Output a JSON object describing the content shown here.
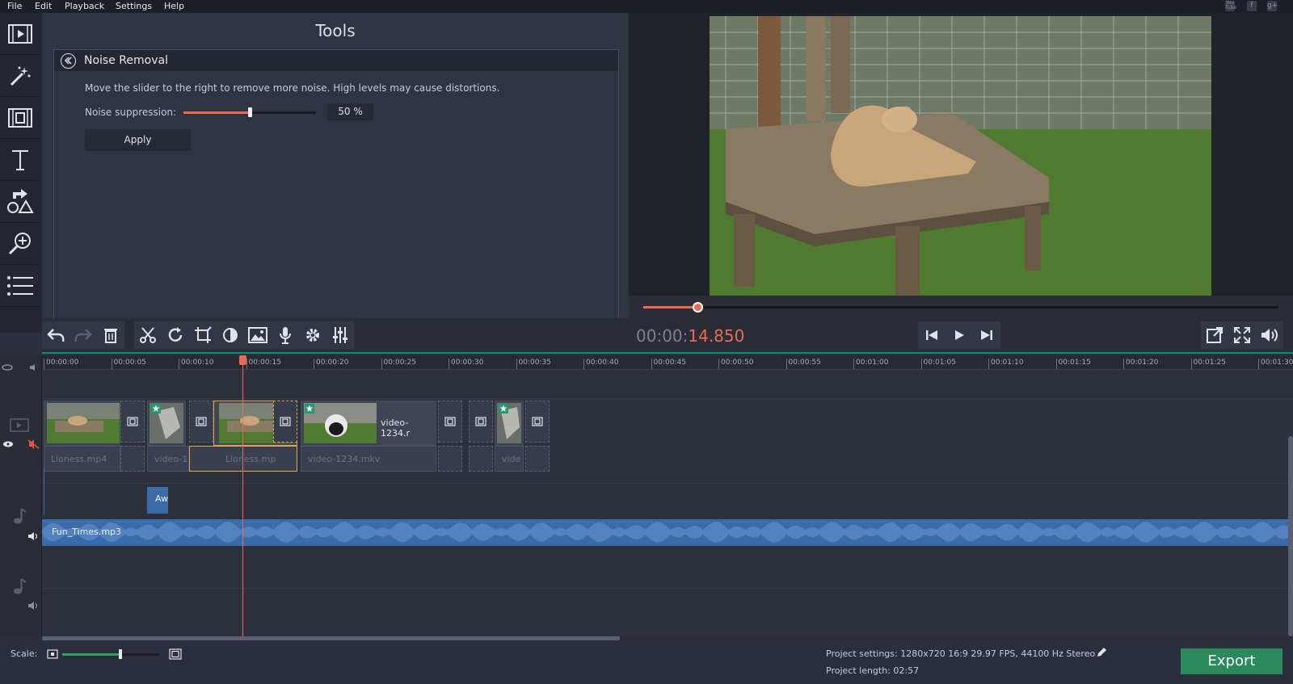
{
  "menu": [
    "File",
    "Edit",
    "Playback",
    "Settings",
    "Help"
  ],
  "social": [
    "You Tube",
    "f",
    "g+"
  ],
  "sidebar": [
    "import-icon",
    "filters-icon",
    "transitions-icon",
    "titles-icon",
    "stickers-icon",
    "zoom-icon",
    "more-tools-icon"
  ],
  "tools": {
    "title": "Tools",
    "panel_title": "Noise Removal",
    "description": "Move the slider to the right to remove more noise. High levels may cause distortions.",
    "slider_label": "Noise suppression:",
    "slider_value": "50 %",
    "slider_fraction": 0.5,
    "apply_label": "Apply"
  },
  "preview": {
    "progress_fraction": 0.085
  },
  "timecode": {
    "base": "00:00:",
    "fraction": "14.850"
  },
  "ruler": [
    "00:00:00",
    "00:00:05",
    "00:00:10",
    "00:00:15",
    "00:00:20",
    "00:00:25",
    "00:00:30",
    "00:00:35",
    "00:00:40",
    "00:00:45",
    "00:00:50",
    "00:00:55",
    "00:01:00",
    "00:01:05",
    "00:01:10",
    "00:01:15",
    "00:01:20",
    "00:01:25",
    "00:01:30"
  ],
  "clips": {
    "video_label": "video-1234.r",
    "audio1": "Lioness.mp4",
    "audio2": "video-1",
    "audio3": "Lioness.mp",
    "audio4": "video-1234.mkv",
    "audio5": "vide",
    "small_clip": "Aw",
    "music": "Fun_Times.mp3"
  },
  "status": {
    "scale_label": "Scale:",
    "scale_fraction": 0.6,
    "project_settings": "Project settings:  1280x720 16:9 29.97 FPS, 44100 Hz Stereo",
    "project_length": "Project length:    02:57",
    "export_label": "Export"
  },
  "colors": {
    "accent": "#ea6a53",
    "export": "#2a8a5c",
    "music": "#3b6ba8"
  }
}
